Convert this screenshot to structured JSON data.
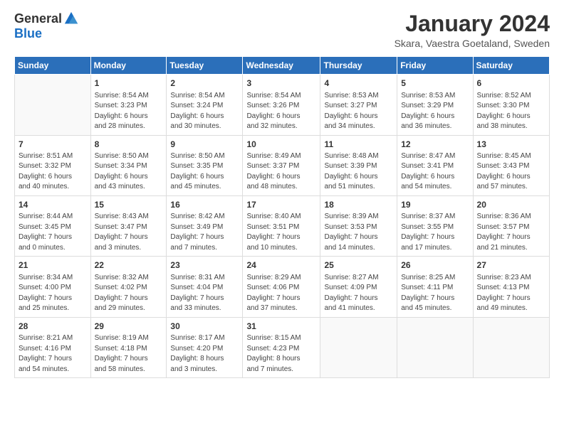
{
  "logo": {
    "general": "General",
    "blue": "Blue"
  },
  "title": "January 2024",
  "location": "Skara, Vaestra Goetaland, Sweden",
  "days_header": [
    "Sunday",
    "Monday",
    "Tuesday",
    "Wednesday",
    "Thursday",
    "Friday",
    "Saturday"
  ],
  "weeks": [
    [
      {
        "day": "",
        "info": ""
      },
      {
        "day": "1",
        "info": "Sunrise: 8:54 AM\nSunset: 3:23 PM\nDaylight: 6 hours\nand 28 minutes."
      },
      {
        "day": "2",
        "info": "Sunrise: 8:54 AM\nSunset: 3:24 PM\nDaylight: 6 hours\nand 30 minutes."
      },
      {
        "day": "3",
        "info": "Sunrise: 8:54 AM\nSunset: 3:26 PM\nDaylight: 6 hours\nand 32 minutes."
      },
      {
        "day": "4",
        "info": "Sunrise: 8:53 AM\nSunset: 3:27 PM\nDaylight: 6 hours\nand 34 minutes."
      },
      {
        "day": "5",
        "info": "Sunrise: 8:53 AM\nSunset: 3:29 PM\nDaylight: 6 hours\nand 36 minutes."
      },
      {
        "day": "6",
        "info": "Sunrise: 8:52 AM\nSunset: 3:30 PM\nDaylight: 6 hours\nand 38 minutes."
      }
    ],
    [
      {
        "day": "7",
        "info": "Sunrise: 8:51 AM\nSunset: 3:32 PM\nDaylight: 6 hours\nand 40 minutes."
      },
      {
        "day": "8",
        "info": "Sunrise: 8:50 AM\nSunset: 3:34 PM\nDaylight: 6 hours\nand 43 minutes."
      },
      {
        "day": "9",
        "info": "Sunrise: 8:50 AM\nSunset: 3:35 PM\nDaylight: 6 hours\nand 45 minutes."
      },
      {
        "day": "10",
        "info": "Sunrise: 8:49 AM\nSunset: 3:37 PM\nDaylight: 6 hours\nand 48 minutes."
      },
      {
        "day": "11",
        "info": "Sunrise: 8:48 AM\nSunset: 3:39 PM\nDaylight: 6 hours\nand 51 minutes."
      },
      {
        "day": "12",
        "info": "Sunrise: 8:47 AM\nSunset: 3:41 PM\nDaylight: 6 hours\nand 54 minutes."
      },
      {
        "day": "13",
        "info": "Sunrise: 8:45 AM\nSunset: 3:43 PM\nDaylight: 6 hours\nand 57 minutes."
      }
    ],
    [
      {
        "day": "14",
        "info": "Sunrise: 8:44 AM\nSunset: 3:45 PM\nDaylight: 7 hours\nand 0 minutes."
      },
      {
        "day": "15",
        "info": "Sunrise: 8:43 AM\nSunset: 3:47 PM\nDaylight: 7 hours\nand 3 minutes."
      },
      {
        "day": "16",
        "info": "Sunrise: 8:42 AM\nSunset: 3:49 PM\nDaylight: 7 hours\nand 7 minutes."
      },
      {
        "day": "17",
        "info": "Sunrise: 8:40 AM\nSunset: 3:51 PM\nDaylight: 7 hours\nand 10 minutes."
      },
      {
        "day": "18",
        "info": "Sunrise: 8:39 AM\nSunset: 3:53 PM\nDaylight: 7 hours\nand 14 minutes."
      },
      {
        "day": "19",
        "info": "Sunrise: 8:37 AM\nSunset: 3:55 PM\nDaylight: 7 hours\nand 17 minutes."
      },
      {
        "day": "20",
        "info": "Sunrise: 8:36 AM\nSunset: 3:57 PM\nDaylight: 7 hours\nand 21 minutes."
      }
    ],
    [
      {
        "day": "21",
        "info": "Sunrise: 8:34 AM\nSunset: 4:00 PM\nDaylight: 7 hours\nand 25 minutes."
      },
      {
        "day": "22",
        "info": "Sunrise: 8:32 AM\nSunset: 4:02 PM\nDaylight: 7 hours\nand 29 minutes."
      },
      {
        "day": "23",
        "info": "Sunrise: 8:31 AM\nSunset: 4:04 PM\nDaylight: 7 hours\nand 33 minutes."
      },
      {
        "day": "24",
        "info": "Sunrise: 8:29 AM\nSunset: 4:06 PM\nDaylight: 7 hours\nand 37 minutes."
      },
      {
        "day": "25",
        "info": "Sunrise: 8:27 AM\nSunset: 4:09 PM\nDaylight: 7 hours\nand 41 minutes."
      },
      {
        "day": "26",
        "info": "Sunrise: 8:25 AM\nSunset: 4:11 PM\nDaylight: 7 hours\nand 45 minutes."
      },
      {
        "day": "27",
        "info": "Sunrise: 8:23 AM\nSunset: 4:13 PM\nDaylight: 7 hours\nand 49 minutes."
      }
    ],
    [
      {
        "day": "28",
        "info": "Sunrise: 8:21 AM\nSunset: 4:16 PM\nDaylight: 7 hours\nand 54 minutes."
      },
      {
        "day": "29",
        "info": "Sunrise: 8:19 AM\nSunset: 4:18 PM\nDaylight: 7 hours\nand 58 minutes."
      },
      {
        "day": "30",
        "info": "Sunrise: 8:17 AM\nSunset: 4:20 PM\nDaylight: 8 hours\nand 3 minutes."
      },
      {
        "day": "31",
        "info": "Sunrise: 8:15 AM\nSunset: 4:23 PM\nDaylight: 8 hours\nand 7 minutes."
      },
      {
        "day": "",
        "info": ""
      },
      {
        "day": "",
        "info": ""
      },
      {
        "day": "",
        "info": ""
      }
    ]
  ]
}
